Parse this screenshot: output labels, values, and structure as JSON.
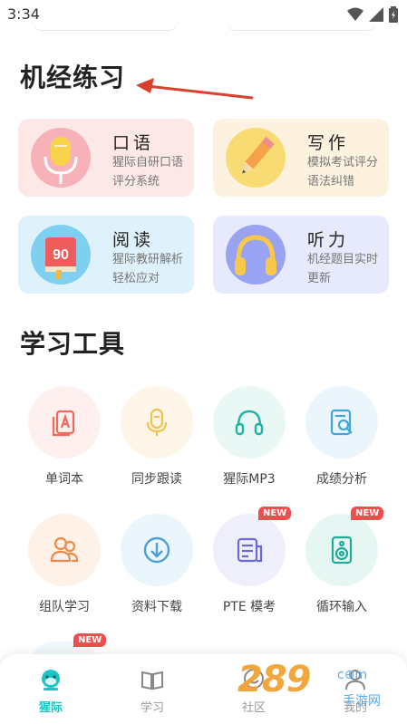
{
  "status_bar": {
    "time": "3:34"
  },
  "sections": {
    "practice_title": "机经练习",
    "tools_title": "学习工具"
  },
  "practice_cards": [
    {
      "title": "口语",
      "desc": "猩际自研口语评分系统",
      "icon": "microphone-icon",
      "bg": "#fde8e8"
    },
    {
      "title": "写作",
      "desc": "模拟考试评分语法纠错",
      "icon": "pencil-icon",
      "bg": "#fdf2df"
    },
    {
      "title": "阅读",
      "desc": "猩际教研解析轻松应对",
      "icon": "book-icon",
      "book_number": "90",
      "bg": "#dff1fb"
    },
    {
      "title": "听力",
      "desc": "机经题目实时更新",
      "icon": "headphones-icon",
      "bg": "#e6eafc"
    }
  ],
  "tools": [
    {
      "label": "单词本",
      "icon": "vocabulary-book-icon"
    },
    {
      "label": "同步跟读",
      "icon": "follow-read-icon"
    },
    {
      "label": "猩际MP3",
      "icon": "headphones-icon"
    },
    {
      "label": "成绩分析",
      "icon": "score-analysis-icon"
    },
    {
      "label": "组队学习",
      "icon": "group-study-icon"
    },
    {
      "label": "资料下载",
      "icon": "download-icon"
    },
    {
      "label": "PTE 模考",
      "icon": "mock-exam-icon",
      "badge": "NEW"
    },
    {
      "label": "循环输入",
      "icon": "speaker-icon",
      "badge": "NEW"
    }
  ],
  "partial_row_badge": "NEW",
  "tab_bar": [
    {
      "label": "猩际",
      "icon": "home-gorilla-icon",
      "active": true
    },
    {
      "label": "学习",
      "icon": "study-book-icon",
      "active": false
    },
    {
      "label": "社区",
      "icon": "community-icon",
      "active": false
    },
    {
      "label": "我的",
      "icon": "profile-icon",
      "active": false
    }
  ],
  "watermark": {
    "text": "289",
    "sub": "c⊕m",
    "sub2": "手游网"
  },
  "colors": {
    "accent": "#1ec3c4",
    "badge": "#ef4e4e",
    "arrow": "#d9412f"
  }
}
